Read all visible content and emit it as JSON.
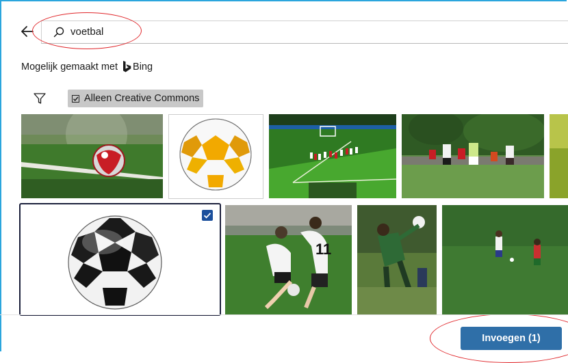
{
  "search": {
    "value": "voetbal"
  },
  "attribution": {
    "text": "Mogelijk gemaakt met",
    "brand": "Bing"
  },
  "filters": {
    "cc_label": "Alleen Creative Commons",
    "cc_checked": true
  },
  "images": [
    {
      "name": "ball-on-field-thumbnail",
      "selected": false
    },
    {
      "name": "yellow-ball-thumbnail",
      "selected": false
    },
    {
      "name": "corner-kick-thumbnail",
      "selected": false
    },
    {
      "name": "players-match-thumbnail",
      "selected": false
    },
    {
      "name": "partial-thumbnail",
      "selected": false
    },
    {
      "name": "black-white-ball-thumbnail",
      "selected": true
    },
    {
      "name": "tackle-thumbnail",
      "selected": false
    },
    {
      "name": "kick-thumbnail",
      "selected": false
    },
    {
      "name": "two-players-thumbnail",
      "selected": false
    }
  ],
  "actions": {
    "insert_label": "Invoegen (1)"
  },
  "colors": {
    "accent": "#2f6fa8",
    "annotation": "#e0262a",
    "frame": "#2aa5dd"
  }
}
